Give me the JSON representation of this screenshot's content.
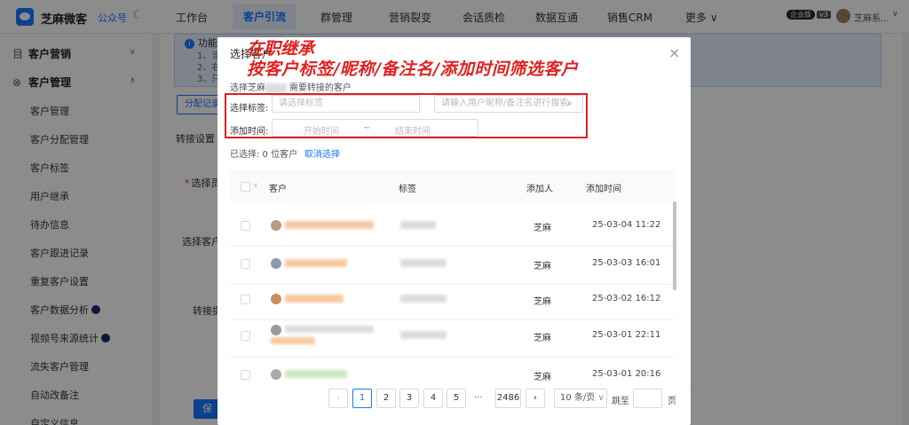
{
  "topbar": {
    "brand": "芝麻微客",
    "brand_link": "公众号",
    "nav": [
      "工作台",
      "客户引流",
      "群管理",
      "营销裂变",
      "会话质检",
      "数据互通",
      "销售CRM",
      "更多 ∨"
    ],
    "active_nav": "客户引流",
    "edition_badge": "企业版",
    "version_badge": "v3",
    "user_name": "芝麻系..."
  },
  "sidebar": {
    "groups": [
      {
        "icon": "目",
        "label": "客户营销"
      },
      {
        "icon": "⊗",
        "label": "客户管理"
      }
    ],
    "items": [
      "客户管理",
      "客户分配管理",
      "客户标签",
      "用户继承",
      "待办信息",
      "客户跟进记录",
      "重复客户设置",
      "客户数据分析",
      "视频号来源统计",
      "流失客户管理",
      "自动改备注",
      "自定义信息"
    ]
  },
  "background": {
    "notice_title": "功能说明",
    "notice_lines": [
      "1、当",
      "2、右",
      "3、只"
    ],
    "assign_btn": "分配记录",
    "transfer_settings": "转接设置",
    "select_staff": "选择员",
    "select_customer": "选择客户",
    "transfer_prompt": "转接提",
    "save_btn": "保"
  },
  "modal": {
    "title": "选择客户",
    "subtitle_prefix": "选择芝麻",
    "subtitle_suffix": "需要转接的客户",
    "filter": {
      "tag_label": "选择标签:",
      "tag_placeholder": "请选择标签",
      "search_placeholder": "请输入用户昵称/备注名进行搜索",
      "time_label": "添加时间:",
      "start_placeholder": "开始时间",
      "separator": "~",
      "end_placeholder": "结束时间"
    },
    "selected_text": "已选择: 0 位客户",
    "cancel_select": "取消选择",
    "columns": [
      "客户",
      "标签",
      "添加人",
      "添加时间"
    ],
    "rows": [
      {
        "adder": "芝麻",
        "time": "25-03-04 11:22"
      },
      {
        "adder": "芝麻",
        "time": "25-03-03 16:01"
      },
      {
        "adder": "芝麻",
        "time": "25-03-02 16:12"
      },
      {
        "adder": "芝麻",
        "time": "25-03-01 22:11"
      },
      {
        "adder": "芝麻",
        "time": "25-03-01 20:16"
      }
    ],
    "pagination": {
      "pages": [
        "1",
        "2",
        "3",
        "4",
        "5"
      ],
      "ellipsis": "···",
      "last_page": "2486",
      "page_size": "10 条/页",
      "jump_label": "跳至",
      "page_unit": "页"
    }
  },
  "annotation": {
    "line1": "在职继承",
    "line2": "按客户标签/昵称/备注名/添加时间筛选客户"
  },
  "colors": {
    "accent": "#1677ff",
    "annotation": "#e02020"
  }
}
